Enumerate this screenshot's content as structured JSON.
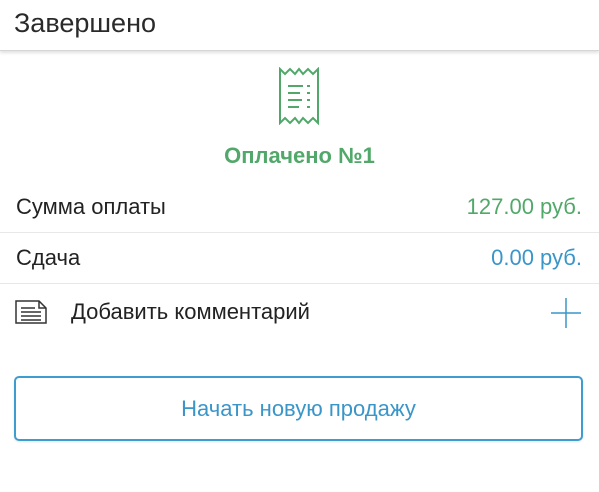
{
  "header": {
    "title": "Завершено"
  },
  "receipt": {
    "icon": "receipt-icon",
    "paid_title": "Оплачено №1"
  },
  "summary": {
    "amount_label": "Сумма оплаты",
    "amount_value": "127.00 руб.",
    "change_label": "Сдача",
    "change_value": "0.00 руб."
  },
  "comment": {
    "icon": "document-icon",
    "label": "Добавить комментарий",
    "add_icon": "plus-icon"
  },
  "actions": {
    "new_sale_label": "Начать новую продажу"
  },
  "colors": {
    "green": "#52a86a",
    "blue": "#3a95c9",
    "text": "#222222"
  }
}
